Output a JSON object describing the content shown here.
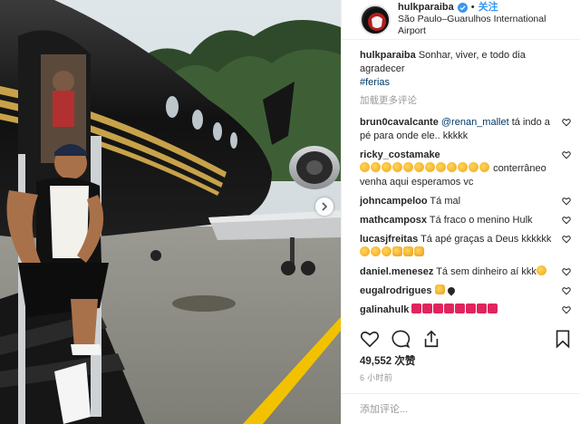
{
  "header": {
    "username": "hulkparaiba",
    "separator": "•",
    "follow_label": "关注",
    "location": "São Paulo–Guarulhos International Airport"
  },
  "caption": {
    "username": "hulkparaiba",
    "text": "Sonhar, viver, e todo dia agradecer",
    "hashtag": "#ferias"
  },
  "load_more_label": "加载更多评论",
  "comments": [
    {
      "user": "brun0cavalcante",
      "mention": "@renan_mallet",
      "text": "tá indo a pé para onde ele.. kkkkk",
      "emojis": []
    },
    {
      "user": "ricky_costamake",
      "mention": "",
      "text": "conterrâneo venha aqui esperamos vc",
      "emojis_before": [
        "clap",
        "clap",
        "clap",
        "clap",
        "clap",
        "clap",
        "clap",
        "clap",
        "clap",
        "clap",
        "clap",
        "clap"
      ],
      "emojis": []
    },
    {
      "user": "johncampeloo",
      "mention": "",
      "text": "Tá mal",
      "emojis": []
    },
    {
      "user": "mathcamposx",
      "mention": "",
      "text": "Tá fraco o menino Hulk",
      "emojis": []
    },
    {
      "user": "lucasjfreitas",
      "mention": "",
      "text": "Tá apé graças a Deus kkkkkk",
      "emojis": [
        "clap",
        "clap",
        "clap",
        "pray",
        "pray",
        "pray"
      ]
    },
    {
      "user": "daniel.menesez",
      "mention": "",
      "text": "Tá sem dinheiro aí kkk",
      "emojis": [
        "face"
      ]
    },
    {
      "user": "eugalrodrigues",
      "mention": "",
      "text": "",
      "emojis": [
        "pray",
        "blk"
      ]
    },
    {
      "user": "galinahulk",
      "mention": "",
      "text": "",
      "emojis": [
        "hrt",
        "hrt",
        "hrt",
        "hrt",
        "hrt",
        "hrt",
        "hrt",
        "hrt"
      ]
    }
  ],
  "icons": {
    "like": "heart-icon",
    "comment": "comment-icon",
    "share": "share-icon",
    "save": "bookmark-icon",
    "next": "chevron-right-icon",
    "verified": "verified-badge-icon"
  },
  "likes_text": "49,552 次赞",
  "timestamp": "6 小时前",
  "add_comment_placeholder": "添加评论...",
  "colors": {
    "link": "#003569",
    "follow": "#3897f0",
    "muted": "#999999",
    "text": "#262626",
    "runway_line": "#f2c200"
  }
}
